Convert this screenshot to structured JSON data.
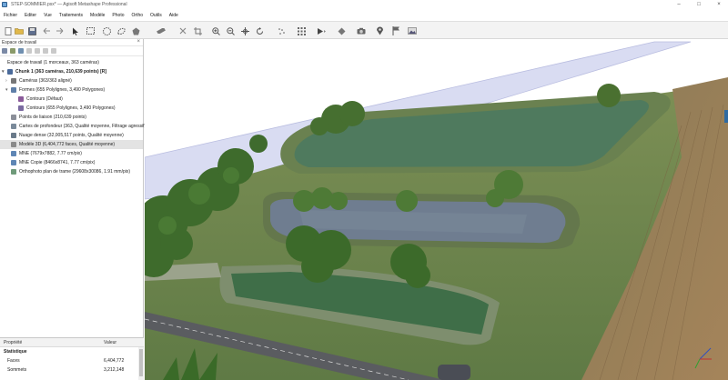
{
  "window": {
    "title": "STEP-SOMMIER.psx* — Agisoft Metashape Professional",
    "minimize": "–",
    "maximize": "□",
    "close": "×"
  },
  "menu": [
    "Fichier",
    "Editer",
    "Vue",
    "Traitements",
    "Modèle",
    "Photo",
    "Ortho",
    "Outils",
    "Aide"
  ],
  "toolbar": {
    "icons": [
      "new-file-icon",
      "open-icon",
      "save-icon",
      "undo-icon",
      "redo-icon",
      "navigation-icon",
      "rectangle-selection-icon",
      "circle-selection-icon",
      "free-selection-icon",
      "shape-icon",
      "ruler-icon",
      "delete-icon",
      "crop-icon",
      "zoom-in-icon",
      "zoom-out-icon",
      "move-icon",
      "rotate-icon",
      "points-icon",
      "grid-icon",
      "model-view-icon",
      "shading-icon",
      "camera-icon",
      "marker-icon",
      "flag-icon",
      "image-icon"
    ]
  },
  "workspace": {
    "header": "Espace de travail",
    "close": "×",
    "tree": [
      {
        "label": "Espace de travail (1 morceaux, 363 caméras)",
        "bold": false,
        "indent": 0,
        "twisty": "",
        "icon": "workspace-icon"
      },
      {
        "label": "Chunk 1 (363 caméras, 210,639 points) [R]",
        "bold": true,
        "indent": 0,
        "twisty": "▾",
        "icon": "chunk-icon"
      },
      {
        "label": "Caméras (363/363 aligné)",
        "bold": false,
        "indent": 1,
        "twisty": "›",
        "icon": "cameras-icon"
      },
      {
        "label": "Formes (655 Polylignes, 3,490 Polygones)",
        "bold": false,
        "indent": 1,
        "twisty": "▾",
        "icon": "shapes-icon"
      },
      {
        "label": "Contours (Défaut)",
        "bold": false,
        "indent": 3,
        "twisty": "",
        "icon": "contours-icon"
      },
      {
        "label": "Contours (655 Polylignes, 3,490 Polygones)",
        "bold": false,
        "indent": 3,
        "twisty": "",
        "icon": "contours-layer-icon"
      },
      {
        "label": "Points de liaison (210,639 points)",
        "bold": false,
        "indent": 1,
        "twisty": "",
        "icon": "tie-points-icon"
      },
      {
        "label": "Cartes de profondeur (363, Qualité moyenne, Filtrage agressif)",
        "bold": false,
        "indent": 1,
        "twisty": "",
        "icon": "depth-maps-icon"
      },
      {
        "label": "Nuage dense (32,005,517 points, Qualité moyenne)",
        "bold": false,
        "indent": 1,
        "twisty": "",
        "icon": "dense-cloud-icon"
      },
      {
        "label": "Modèle 3D (6,404,772 faces, Qualité moyenne)",
        "bold": false,
        "indent": 1,
        "twisty": "",
        "icon": "model-icon",
        "selected": true
      },
      {
        "label": "MNE (7679x7882, 7.77 cm/pix)",
        "bold": false,
        "indent": 1,
        "twisty": "",
        "icon": "dem-icon"
      },
      {
        "label": "MNE Copie (8466x8741, 7.77 cm/pix)",
        "bold": false,
        "indent": 1,
        "twisty": "",
        "icon": "dem-copy-icon"
      },
      {
        "label": "Orthophoto plan de trame (29608x30086, 1.91 mm/pix)",
        "bold": false,
        "indent": 1,
        "twisty": "",
        "icon": "orthomosaic-icon"
      }
    ]
  },
  "properties": {
    "col_property": "Propriété",
    "col_value": "Valeur",
    "rows": [
      {
        "name": "Statistique",
        "value": ""
      },
      {
        "name": "Faces",
        "value": "6,404,772"
      },
      {
        "name": "Sommets",
        "value": "3,212,148"
      }
    ]
  },
  "colors": {
    "toolbar_bg": "#f3f3f3",
    "selection": "#e3e3e3",
    "grass": "#6f8f52",
    "water": "#4f7a5e",
    "trees": "#3e6b2c",
    "field": "#9b7f5c",
    "road": "#5a5c60",
    "sky_plane": "#d9dcf2"
  }
}
